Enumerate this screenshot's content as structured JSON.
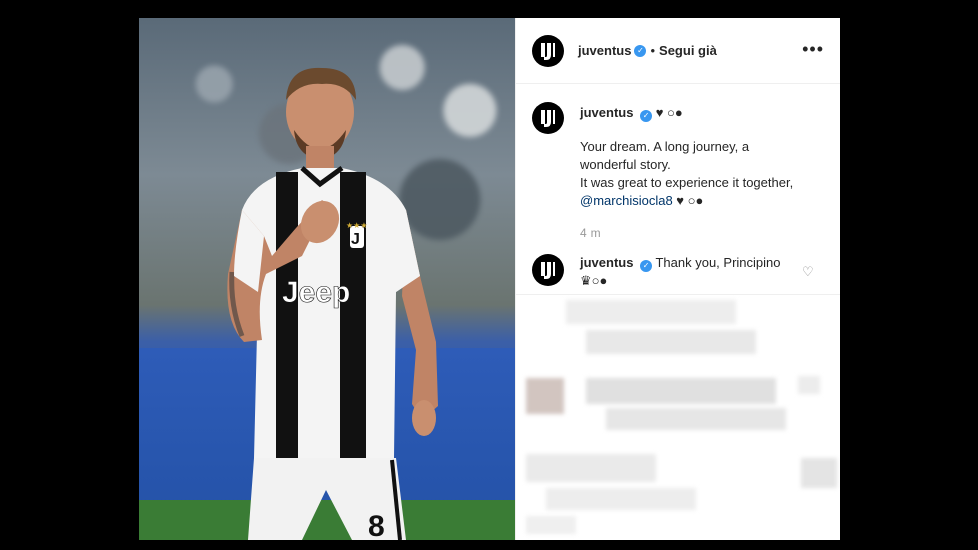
{
  "post": {
    "author": "juventus",
    "follow_status": "Segui già",
    "more_label": "•••"
  },
  "caption": {
    "author": "juventus",
    "suffix": "♥ ○●",
    "line1": "Your dream. A long journey, a",
    "line2": "wonderful story.",
    "line3": "It was great to experience it together,",
    "mention": "@marchisiocla8",
    "mention_suffix": "♥ ○●",
    "time": "4 m"
  },
  "comment": {
    "author": "juventus",
    "text": "Thank you, Principino",
    "emoji": "♛○●"
  },
  "colors": {
    "verified": "#3897f0",
    "jersey_black": "#111111",
    "jersey_white": "#f4f4f4"
  },
  "icons": [
    "juventus-logo-icon",
    "verified-badge-icon",
    "more-options-icon",
    "like-heart-icon"
  ]
}
